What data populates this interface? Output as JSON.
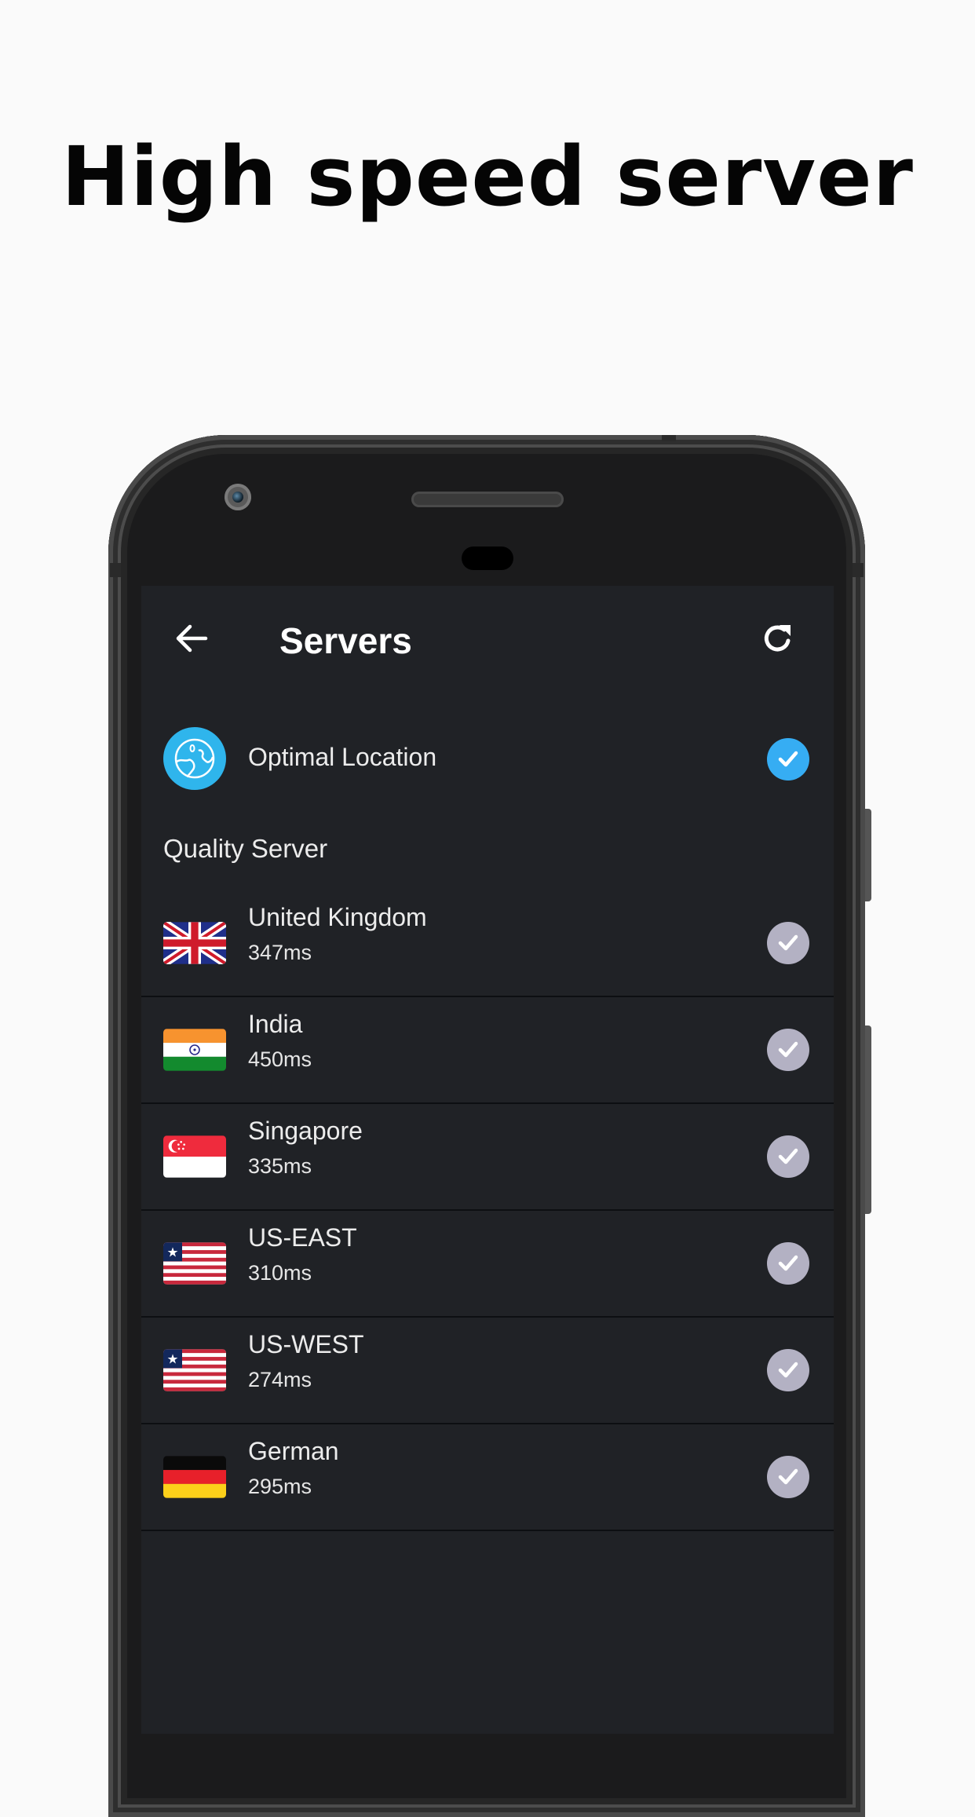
{
  "headline": "High speed server",
  "app": {
    "title": "Servers",
    "back_icon": "arrow-left-icon",
    "refresh_icon": "refresh-icon"
  },
  "optimal": {
    "label": "Optimal Location",
    "icon": "globe-icon",
    "selected": true
  },
  "section_label": "Quality Server",
  "servers": [
    {
      "name": "United Kingdom",
      "ping": "347ms",
      "flag": "uk-flag-icon",
      "selected": false
    },
    {
      "name": "India",
      "ping": "450ms",
      "flag": "india-flag-icon",
      "selected": false
    },
    {
      "name": "Singapore",
      "ping": "335ms",
      "flag": "singapore-flag-icon",
      "selected": false
    },
    {
      "name": "US-EAST",
      "ping": "310ms",
      "flag": "us-flag-icon",
      "selected": false
    },
    {
      "name": "US-WEST",
      "ping": "274ms",
      "flag": "us-flag-icon",
      "selected": false
    },
    {
      "name": "German",
      "ping": "295ms",
      "flag": "germany-flag-icon",
      "selected": false
    }
  ],
  "colors": {
    "accent": "#36adf3",
    "globe": "#2fb5ec",
    "unselected_check": "#b3b1c3",
    "screen_bg": "#202226"
  }
}
